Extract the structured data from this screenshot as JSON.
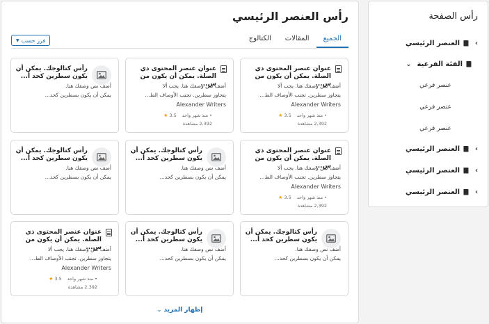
{
  "sidebar": {
    "title": "رأس الصفحة",
    "items": [
      {
        "label": "العنصر الرئيسي",
        "icon": "book-icon",
        "chevron": "chevron-left-icon"
      },
      {
        "label": "الفئة الفرعية",
        "icon": "book-icon",
        "chevron": "chevron-down-icon"
      },
      {
        "label": "العنصر الرئيسي",
        "icon": "book-icon",
        "chevron": "chevron-left-icon"
      },
      {
        "label": "العنصر الرئيسي",
        "icon": "book-icon",
        "chevron": "chevron-left-icon"
      },
      {
        "label": "العنصر الرئيسي",
        "icon": "book-icon",
        "chevron": "chevron-left-icon"
      }
    ],
    "subitems": [
      "عنصر فرعي",
      "عنصر فرعي",
      "عنصر فرعي"
    ]
  },
  "main": {
    "title": "رأس العنصر الرئيسي",
    "tabs": [
      {
        "label": "الجميع",
        "active": true
      },
      {
        "label": "المقالات",
        "active": false
      },
      {
        "label": "الكتالوج",
        "active": false
      }
    ],
    "sort_label": "فرز حسب",
    "show_more": "إظهار المزيد",
    "cards": [
      {
        "kind": "article",
        "title": "عنوان عنصر المحتوى ذي الصلة. يمكن أن يكون من س...",
        "desc1": "أضف نص وصفك هنا. يجب ألا",
        "desc2": "يتجاوز سطرين. تجنب الأوصاف الط...",
        "author": "Alexander Writers",
        "rating": "3.5",
        "age": "منذ شهر واحد",
        "views": "2,392 مشاهدة"
      },
      {
        "kind": "article",
        "title": "عنوان عنصر المحتوى ذي الصلة. يمكن أن يكون من س...",
        "desc1": "أضف نص وصفك هنا. يجب ألا",
        "desc2": "يتجاوز سطرين. تجنب الأوصاف الط...",
        "author": "Alexander Writers",
        "rating": "3.5",
        "age": "منذ شهر واحد",
        "views": "2,392 مشاهدة"
      },
      {
        "kind": "catalog",
        "title": "رأس كتالوجك. يمكن أن يكون سطرين كحد أ...",
        "desc1": "أضف نص وصفك هنا.",
        "desc2": "يمكن أن يكون بسطرين كحد..."
      },
      {
        "kind": "article",
        "title": "عنوان عنصر المحتوى ذي الصلة. يمكن أن يكون من س...",
        "desc1": "أضف نص وصفك هنا. يجب ألا",
        "desc2": "يتجاوز سطرين. تجنب الأوصاف الط...",
        "author": "Alexander Writers",
        "rating": "3.5",
        "age": "منذ شهر واحد",
        "views": "2,392 مشاهدة"
      },
      {
        "kind": "catalog",
        "title": "رأس كتالوجك. يمكن أن يكون سطرين كحد أ...",
        "desc1": "أضف نص وصفك هنا.",
        "desc2": "يمكن أن يكون بسطرين كحد..."
      },
      {
        "kind": "catalog",
        "title": "رأس كتالوجك. يمكن أن يكون سطرين كحد أ...",
        "desc1": "أضف نص وصفك هنا.",
        "desc2": "يمكن أن يكون بسطرين كحد..."
      },
      {
        "kind": "catalog",
        "title": "رأس كتالوجك. يمكن أن يكون سطرين كحد أ...",
        "desc1": "أضف نص وصفك هنا.",
        "desc2": "يمكن أن يكون بسطرين كحد..."
      },
      {
        "kind": "catalog",
        "title": "رأس كتالوجك. يمكن أن يكون سطرين كحد أ...",
        "desc1": "أضف نص وصفك هنا.",
        "desc2": "يمكن أن يكون بسطرين كحد..."
      },
      {
        "kind": "article",
        "title": "عنوان عنصر المحتوى ذي الصلة. يمكن أن يكون من س...",
        "desc1": "أضف نص وصفك هنا. يجب ألا",
        "desc2": "يتجاوز سطرين. تجنب الأوصاف الط...",
        "author": "Alexander Writers",
        "rating": "3.5",
        "age": "منذ شهر واحد",
        "views": "2,392 مشاهدة"
      }
    ]
  },
  "colors": {
    "accent": "#1c6fb0",
    "star": "#e9a118"
  }
}
